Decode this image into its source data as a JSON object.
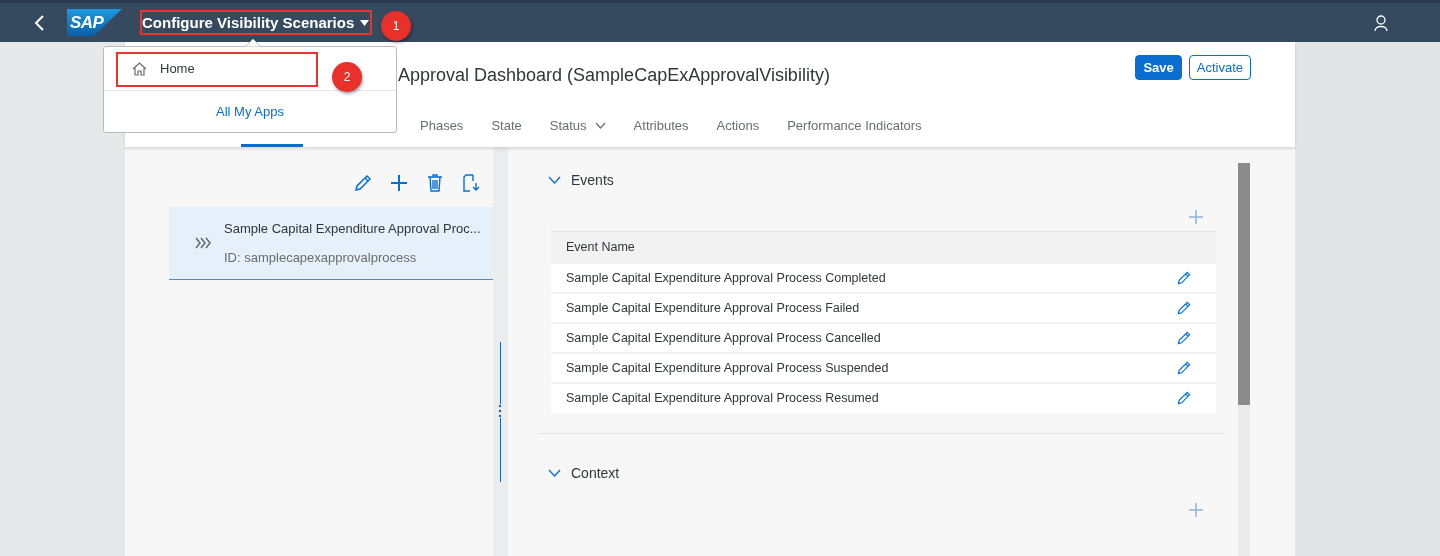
{
  "shell": {
    "logo": "SAP",
    "title": "Configure Visibility Scenarios"
  },
  "menu": {
    "items": [
      {
        "label": "Home",
        "kind": "home"
      }
    ],
    "footer_link": "All My Apps"
  },
  "annotations": [
    {
      "label": "1"
    },
    {
      "label": "2"
    }
  ],
  "header": {
    "title": "Approval Dashboard (SampleCapExApprovalVisibility)",
    "buttons": [
      {
        "label": "Save",
        "kind": "primary"
      },
      {
        "label": "Activate",
        "kind": "secondary"
      }
    ]
  },
  "tabs": [
    {
      "kind": "covered"
    },
    {
      "kind": "covered",
      "selected": true
    },
    {
      "kind": "covered"
    },
    {
      "label": "Phases",
      "selected": false
    },
    {
      "label": "State",
      "selected": false
    },
    {
      "label": "Status",
      "selected": false,
      "has_menu": true
    },
    {
      "label": "Attributes",
      "selected": false
    },
    {
      "label": "Actions",
      "selected": false
    },
    {
      "label": "Performance Indicators",
      "selected": false
    }
  ],
  "processes": [
    {
      "title": "Sample Capital Expenditure Approval Proc...",
      "id": "ID: samplecapexapprovalprocess",
      "selected": true
    }
  ],
  "sections": [
    {
      "title": "Events",
      "expanded": true,
      "table": {
        "columns": [
          "Event Name"
        ],
        "rows": [
          [
            "Sample Capital Expenditure Approval Process Completed"
          ],
          [
            "Sample Capital Expenditure Approval Process Failed"
          ],
          [
            "Sample Capital Expenditure Approval Process Cancelled"
          ],
          [
            "Sample Capital Expenditure Approval Process Suspended"
          ],
          [
            "Sample Capital Expenditure Approval Process Resumed"
          ]
        ]
      }
    },
    {
      "title": "Context",
      "expanded": true
    }
  ]
}
